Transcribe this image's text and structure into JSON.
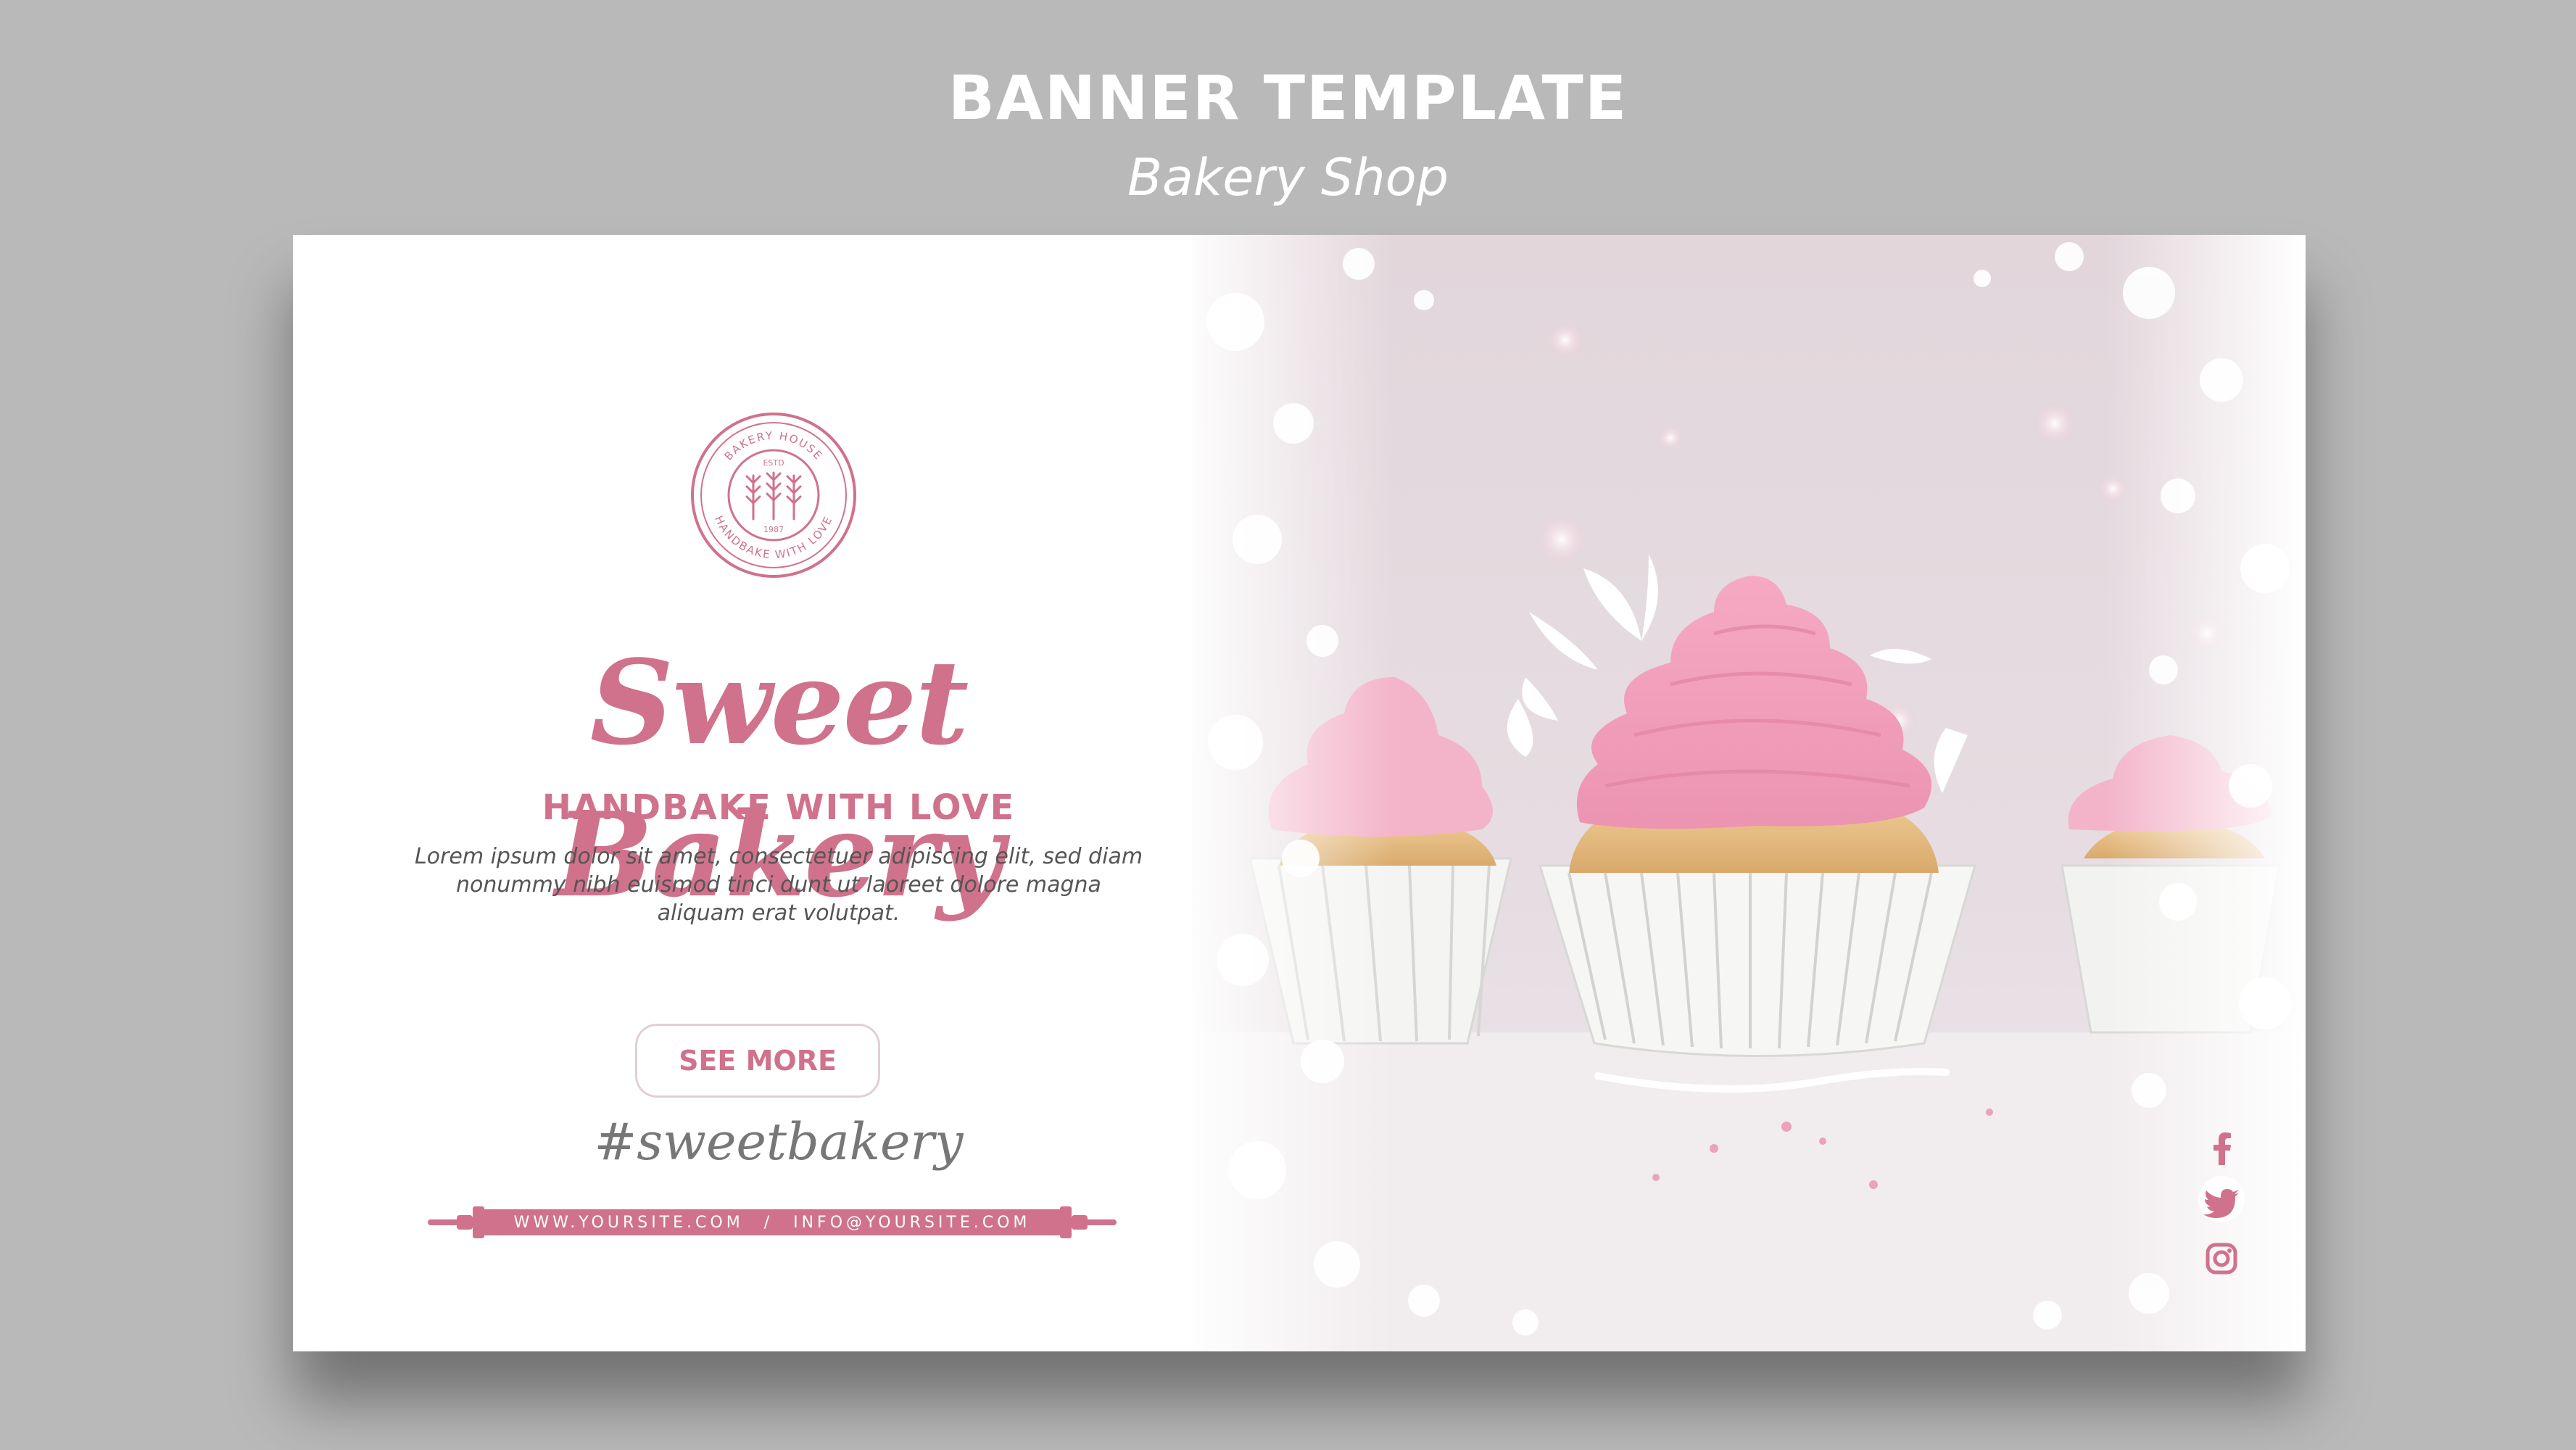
{
  "page": {
    "title": "BANNER TEMPLATE",
    "subtitle": "Bakery Shop"
  },
  "banner": {
    "logo": {
      "top_text": "BAKERY HOUSE",
      "estd": "ESTD",
      "year": "1987",
      "bottom_text": "HANDBAKE WITH LOVE"
    },
    "headline": "Sweet Bakery",
    "tagline": "HANDBAKE WITH LOVE",
    "body": "Lorem ipsum dolor sit amet, consectetuer adipiscing elit, sed diam nonummy nibh euismod tinci dunt ut laoreet dolore magna aliquam erat volutpat.",
    "button_label": "SEE MORE",
    "hashtag": "#sweetbakery",
    "website": "WWW.YOURSITE.COM",
    "separator": "/",
    "email": "INFO@YOURSITE.COM",
    "social_icons": [
      "facebook-icon",
      "twitter-icon",
      "instagram-icon"
    ]
  },
  "colors": {
    "accent": "#d0728c",
    "frosting": "#f2a6c0",
    "background": "#b9b9b9"
  }
}
